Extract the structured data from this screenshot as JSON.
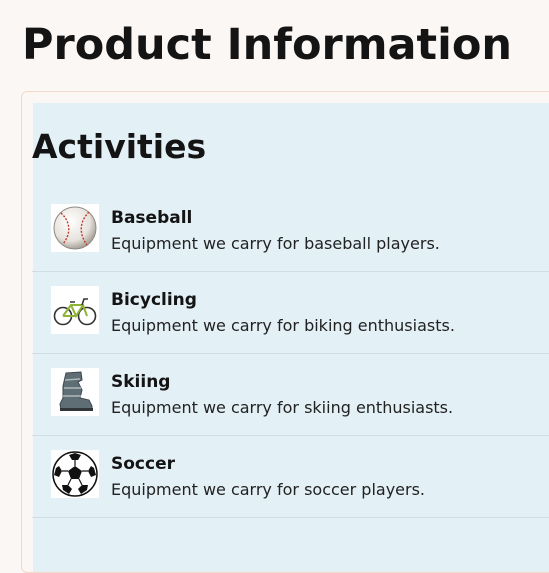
{
  "page": {
    "title": "Product Information"
  },
  "section": {
    "title": "Activities"
  },
  "activities": [
    {
      "name": "Baseball",
      "description": "Equipment we carry for baseball players.",
      "icon": "baseball-icon"
    },
    {
      "name": "Bicycling",
      "description": "Equipment we carry for biking enthusiasts.",
      "icon": "bicycle-icon"
    },
    {
      "name": "Skiing",
      "description": "Equipment we carry for skiing enthusiasts.",
      "icon": "ski-boot-icon"
    },
    {
      "name": "Soccer",
      "description": "Equipment we carry for soccer players.",
      "icon": "soccer-ball-icon"
    }
  ]
}
